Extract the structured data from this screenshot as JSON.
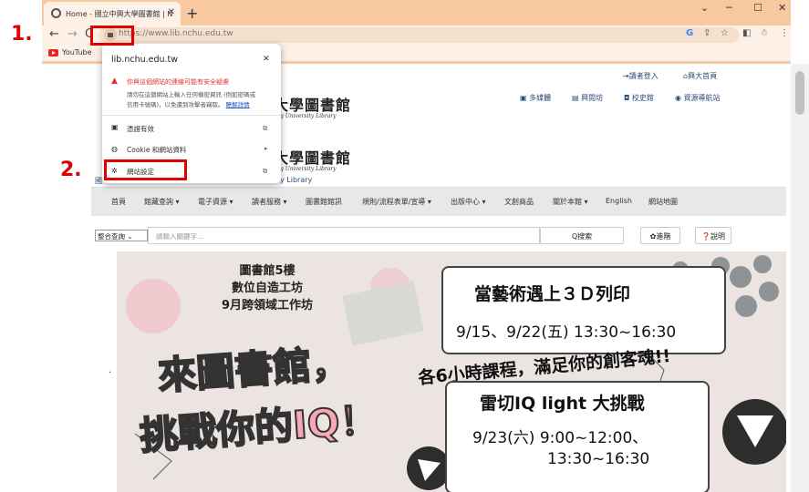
{
  "browser": {
    "tab_title": "Home - 國立中興大學圖書館 | N",
    "new_tab": "+",
    "url": "https://www.lib.nchu.edu.tw",
    "bookmark_youtube": "YouTube",
    "win_min": "─",
    "win_max": "☐",
    "win_close": "✕",
    "chevron": "⌄"
  },
  "annotations": {
    "step1": "1.",
    "step2": "2."
  },
  "popup": {
    "domain": "lib.nchu.edu.tw",
    "close": "✕",
    "warning_title": "你與這個網站的連線可能有安全疑慮",
    "warning_line1": "請勿在這個網站上輸入任何機密資訊 (例如密碼或",
    "warning_line2": "信用卡號碼)，以免遭到攻擊者竊取。",
    "warning_link": "瞭解詳情",
    "cert_label": "憑證有效",
    "cookie_label": "Cookie 和網站資料",
    "settings_label": "網站設定"
  },
  "site": {
    "top_login": "讀者登入",
    "top_home": "興大首頁",
    "nav_multimedia": "多媒體",
    "nav_reading": "興閱坊",
    "nav_history": "校史館",
    "nav_resources": "資源導航站",
    "logo_cn": "大學圖書館",
    "logo_en": "g University Library",
    "logo_en2": "y Library",
    "logo_left": "國",
    "menu": [
      "首頁",
      "館藏查詢 ▾",
      "電子資源 ▾",
      "讀者服務 ▾",
      "圖書館館訊",
      "規則/流程表單/宣導 ▾",
      "出版中心 ▾",
      "文創商品",
      "關於本館 ▾",
      "English",
      "網站地圖"
    ],
    "search_select": "整合查詢  ⌄",
    "search_placeholder": "請輸入關鍵字...",
    "search_btn": "Q搜索",
    "advanced_btn": "✿進階",
    "help_btn": "❓說明"
  },
  "banner": {
    "left_line1": "圖書館5樓",
    "left_line2": "數位自造工坊",
    "left_line3": "9月跨領域工作坊",
    "big1": "來圖書館，",
    "big2": "挑戰你的IQ！",
    "panel1_title": "當藝術遇上３Ｄ列印",
    "panel1_date": "9/15、9/22(五) 13:30~16:30",
    "course": "各6小時課程，滿足你的創客魂!!",
    "panel2_title": "雷切IQ light 大挑戰",
    "panel2_date1": "9/23(六) 9:00~12:00、",
    "panel2_date2": "13:30~16:30"
  },
  "colors": {
    "accent_red": "#e00000",
    "chrome_bg": "#f8c89f",
    "link": "#2a4c7a"
  }
}
